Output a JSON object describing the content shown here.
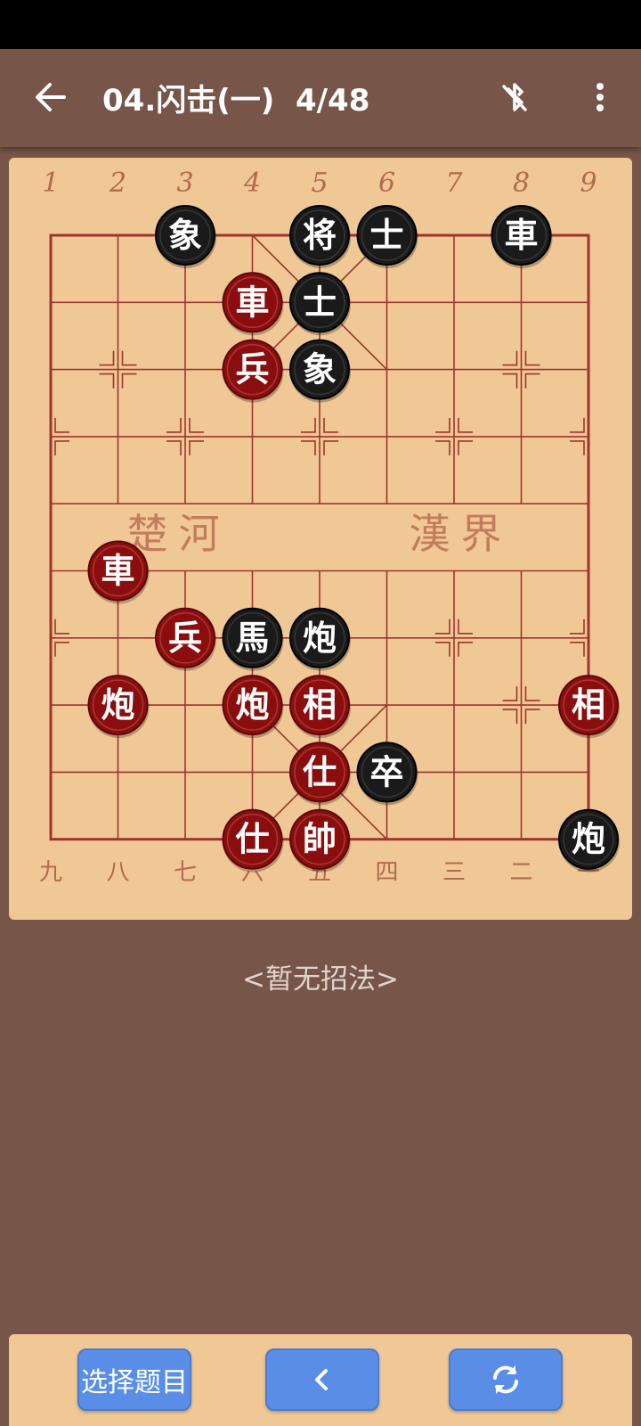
{
  "app_bar": {
    "title": "04.闪击(一)  4/48",
    "back_icon": "arrow-back-icon",
    "bluetooth_icon": "bluetooth-disabled-icon",
    "more_icon": "more-vert-icon"
  },
  "board": {
    "top_numbers": [
      "1",
      "2",
      "3",
      "4",
      "5",
      "6",
      "7",
      "8",
      "9"
    ],
    "bottom_numbers": [
      "九",
      "八",
      "七",
      "六",
      "五",
      "四",
      "三",
      "二",
      "一"
    ],
    "river_left": "楚河",
    "river_right": "漢界",
    "pieces": [
      {
        "side": "black",
        "label": "象",
        "file": 2,
        "rank": 0
      },
      {
        "side": "black",
        "label": "将",
        "file": 4,
        "rank": 0
      },
      {
        "side": "black",
        "label": "士",
        "file": 5,
        "rank": 0
      },
      {
        "side": "black",
        "label": "車",
        "file": 7,
        "rank": 0
      },
      {
        "side": "red",
        "label": "車",
        "file": 3,
        "rank": 1
      },
      {
        "side": "black",
        "label": "士",
        "file": 4,
        "rank": 1
      },
      {
        "side": "red",
        "label": "兵",
        "file": 3,
        "rank": 2
      },
      {
        "side": "black",
        "label": "象",
        "file": 4,
        "rank": 2
      },
      {
        "side": "red",
        "label": "車",
        "file": 1,
        "rank": 5
      },
      {
        "side": "red",
        "label": "兵",
        "file": 2,
        "rank": 6
      },
      {
        "side": "black",
        "label": "馬",
        "file": 3,
        "rank": 6
      },
      {
        "side": "black",
        "label": "炮",
        "file": 4,
        "rank": 6
      },
      {
        "side": "red",
        "label": "炮",
        "file": 1,
        "rank": 7
      },
      {
        "side": "red",
        "label": "炮",
        "file": 3,
        "rank": 7
      },
      {
        "side": "red",
        "label": "相",
        "file": 4,
        "rank": 7
      },
      {
        "side": "red",
        "label": "相",
        "file": 8,
        "rank": 7
      },
      {
        "side": "red",
        "label": "仕",
        "file": 4,
        "rank": 8
      },
      {
        "side": "black",
        "label": "卒",
        "file": 5,
        "rank": 8
      },
      {
        "side": "red",
        "label": "仕",
        "file": 3,
        "rank": 9
      },
      {
        "side": "red",
        "label": "帥",
        "file": 4,
        "rank": 9
      },
      {
        "side": "black",
        "label": "炮",
        "file": 8,
        "rank": 9
      }
    ],
    "colors": {
      "red": "#8B0E0E",
      "black": "#1a1a1a",
      "line": "#a0342c"
    }
  },
  "status_text": "<暂无招法>",
  "buttons": {
    "select_label": "选择题目",
    "prev_icon": "chevron-left-icon",
    "reset_icon": "sync-icon"
  }
}
